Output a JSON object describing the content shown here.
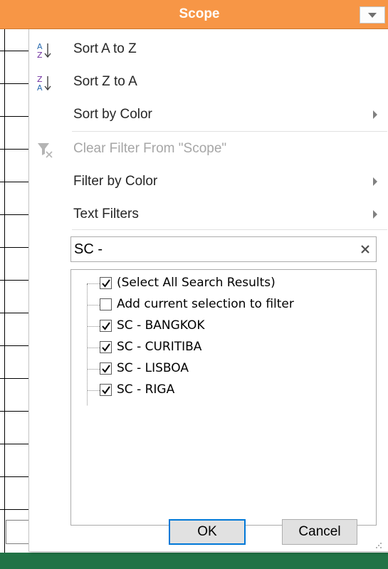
{
  "header": {
    "title": "Scope",
    "dropdown_icon": "dropdown-arrow-icon",
    "color": "#F79646"
  },
  "menu": {
    "items": [
      {
        "label": "Sort A to Z",
        "icon": "sort-a-to-z-icon",
        "enabled": true,
        "has_submenu": false
      },
      {
        "label": "Sort Z to A",
        "icon": "sort-z-to-a-icon",
        "enabled": true,
        "has_submenu": false
      },
      {
        "label": "Sort by Color",
        "icon": "",
        "enabled": true,
        "has_submenu": true
      },
      {
        "label": "Clear Filter From \"Scope\"",
        "icon": "clear-filter-icon",
        "enabled": false,
        "has_submenu": false
      },
      {
        "label": "Filter by Color",
        "icon": "",
        "enabled": true,
        "has_submenu": true
      },
      {
        "label": "Text Filters",
        "icon": "",
        "enabled": true,
        "has_submenu": true
      }
    ]
  },
  "search": {
    "value": "SC -",
    "clear_icon": "clear-search-icon"
  },
  "list": {
    "items": [
      {
        "label": "(Select All Search Results)",
        "checked": true
      },
      {
        "label": "Add current selection to filter",
        "checked": false
      },
      {
        "label": "SC - BANGKOK",
        "checked": true
      },
      {
        "label": "SC - CURITIBA",
        "checked": true
      },
      {
        "label": "SC - LISBOA",
        "checked": true
      },
      {
        "label": "SC - RIGA",
        "checked": true
      }
    ]
  },
  "buttons": {
    "ok_label": "OK",
    "cancel_label": "Cancel"
  },
  "colors": {
    "accent": "#0078d7",
    "status_bar": "#217346"
  }
}
